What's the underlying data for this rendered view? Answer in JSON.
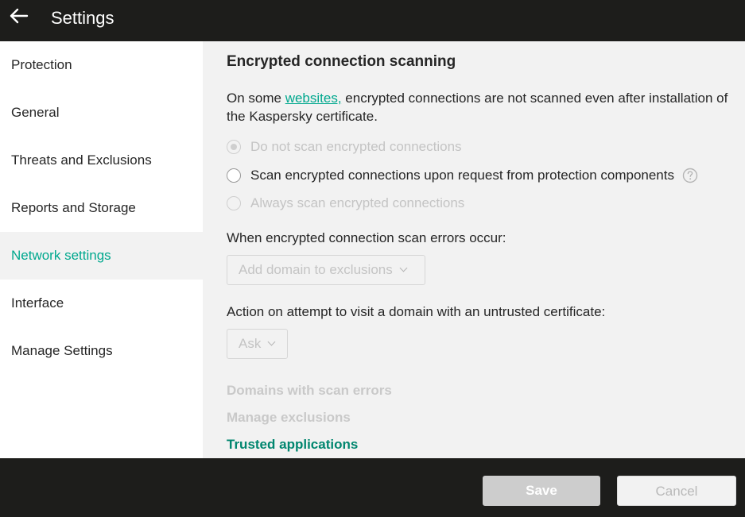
{
  "header": {
    "title": "Settings"
  },
  "sidebar": {
    "items": [
      {
        "label": "Protection"
      },
      {
        "label": "General"
      },
      {
        "label": "Threats and Exclusions"
      },
      {
        "label": "Reports and Storage"
      },
      {
        "label": "Network settings",
        "active": true
      },
      {
        "label": "Interface"
      },
      {
        "label": "Manage Settings"
      }
    ]
  },
  "main": {
    "title": "Encrypted connection scanning",
    "description_prefix": "On some ",
    "description_link": "websites,",
    "description_suffix": " encrypted connections are not scanned even after installation of the Kaspersky certificate.",
    "radios": [
      {
        "label": "Do not scan encrypted connections",
        "checked": true,
        "disabled": true
      },
      {
        "label": "Scan encrypted connections upon request from protection components",
        "checked": false,
        "disabled": false
      },
      {
        "label": "Always scan encrypted connections",
        "checked": false,
        "disabled": true
      }
    ],
    "scan_errors_label": "When encrypted connection scan errors occur:",
    "scan_errors_value": "Add domain to exclusions",
    "untrusted_label": "Action on attempt to visit a domain with an untrusted certificate:",
    "untrusted_value": "Ask",
    "links": [
      {
        "label": "Domains with scan errors",
        "enabled": false
      },
      {
        "label": "Manage exclusions",
        "enabled": false
      },
      {
        "label": "Trusted applications",
        "enabled": true
      }
    ]
  },
  "footer": {
    "save_label": "Save",
    "cancel_label": "Cancel"
  },
  "colors": {
    "accent": "#00a88e",
    "header_bg": "#1d1d1b",
    "content_bg": "#f2f2f2"
  }
}
